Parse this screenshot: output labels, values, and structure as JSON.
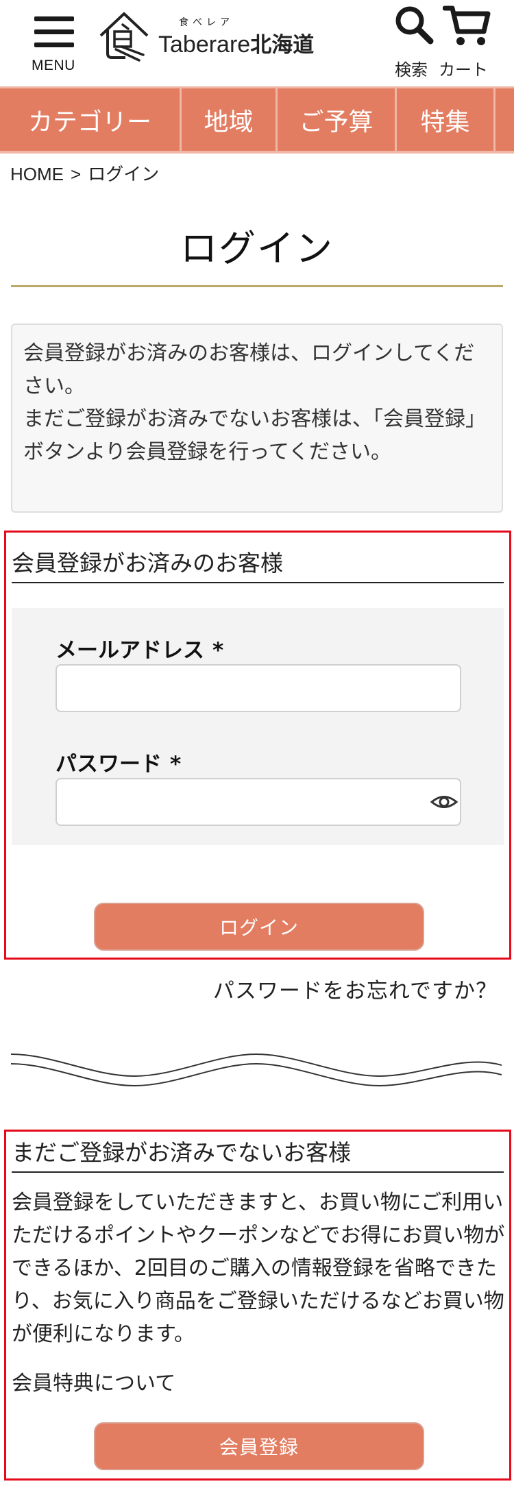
{
  "header": {
    "menu_label": "MENU",
    "logo_kana": "食べレア",
    "logo_brand": "Taberare",
    "logo_region": "北海道",
    "search_label": "検索",
    "cart_label": "カート",
    "icons": {
      "menu": "hamburger-icon",
      "search": "search-icon",
      "cart": "cart-icon"
    }
  },
  "nav": {
    "items": [
      {
        "label": "カテゴリー"
      },
      {
        "label": "地域"
      },
      {
        "label": "ご予算"
      },
      {
        "label": "特集"
      }
    ]
  },
  "breadcrumb": {
    "home": "HOME",
    "separator": ">",
    "current": "ログイン"
  },
  "page": {
    "title": "ログイン"
  },
  "info": {
    "line1": "会員登録がお済みのお客様は、ログインしてください。",
    "line2": "まだご登録がお済みでないお客様は、「会員登録」ボタンより会員登録を行ってください。"
  },
  "login": {
    "heading": "会員登録がお済みのお客様",
    "email_label": "メールアドレス",
    "password_label": "パスワード",
    "required_mark": "*",
    "email_value": "",
    "password_value": "",
    "submit_label": "ログイン",
    "forgot_label": "パスワードをお忘れですか？"
  },
  "register": {
    "heading": "まだご登録がお済みでないお客様",
    "body": "会員登録をしていただきますと、お買い物にご利用いただけるポイントやクーポンなどでお得にお買い物ができるほか、2回目のご購入の情報登録を省略できたり、お気に入り商品をご登録いただけるなどお買い物が便利になります。",
    "benefits_link": "会員特典について",
    "submit_label": "会員登録"
  },
  "colors": {
    "accent": "#e37d62",
    "accent_border": "#f0b7a6",
    "title_rule": "#bba86a",
    "highlight_border": "#e5091a",
    "form_bg": "#f3f3f3"
  }
}
